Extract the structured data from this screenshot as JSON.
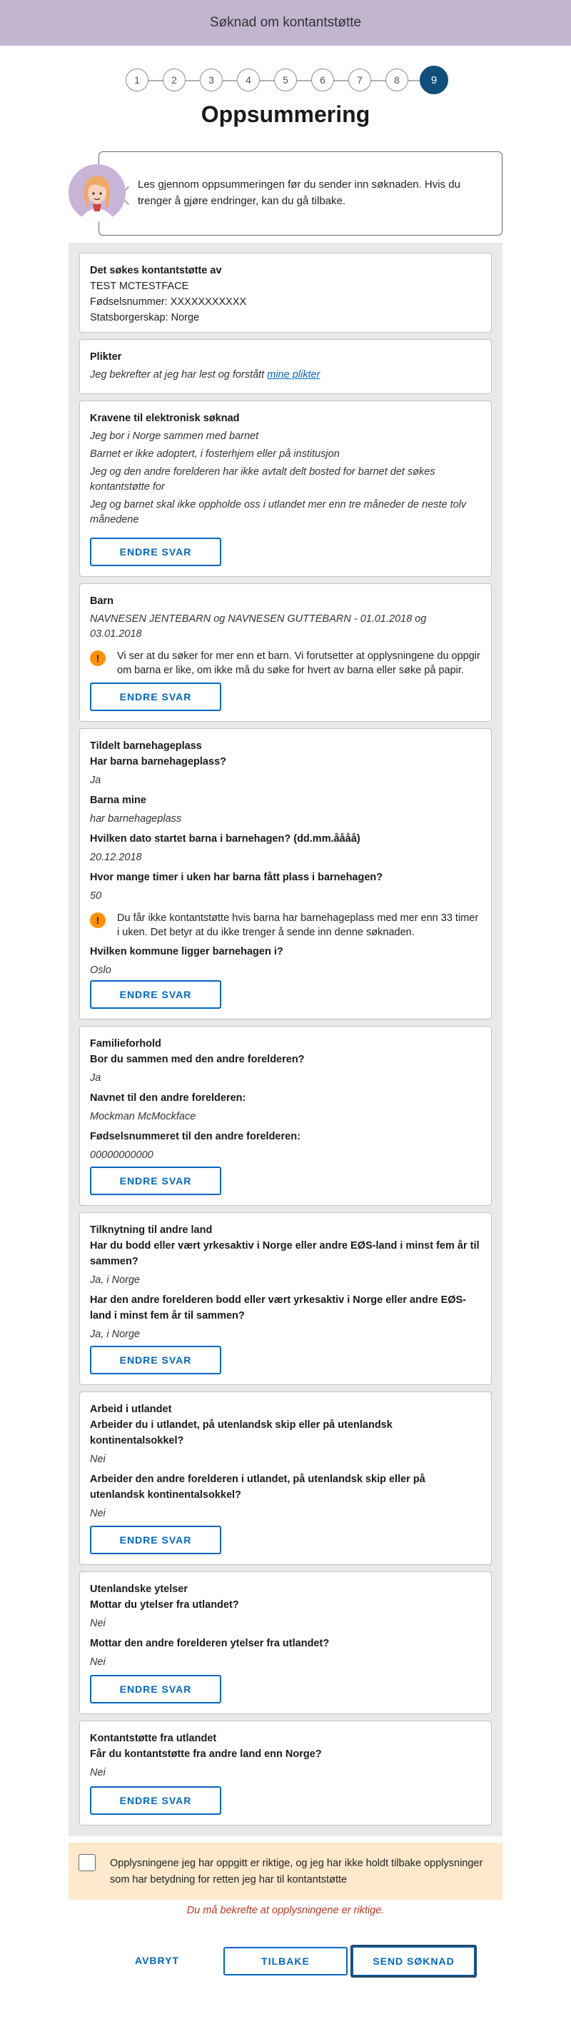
{
  "header": {
    "title": "Søknad om kontantstøtte"
  },
  "stepper": {
    "steps": [
      "1",
      "2",
      "3",
      "4",
      "5",
      "6",
      "7",
      "8",
      "9"
    ],
    "current": 9
  },
  "page": {
    "title": "Oppsummering"
  },
  "guide": {
    "text": "Les gjennom oppsummeringen før du sender inn søknaden. Hvis du trenger å gjøre endringer, kan du gå tilbake."
  },
  "edit_label": "ENDRE SVAR",
  "sections": {
    "applicant": {
      "title": "Det søkes kontantstøtte av",
      "name": "TEST MCTESTFACE",
      "ssn": "Fødselsnummer: XXXXXXXXXXX",
      "citizenship": "Statsborgerskap: Norge"
    },
    "duties": {
      "title": "Plikter",
      "text": "Jeg bekrefter at jeg har lest og forstått ",
      "link": "mine plikter"
    },
    "requirements": {
      "title": "Kravene til elektronisk søknad",
      "items": [
        "Jeg bor i Norge sammen med barnet",
        "Barnet er ikke adoptert, i fosterhjem eller på institusjon",
        "Jeg og den andre forelderen har ikke avtalt delt bosted for barnet det søkes kontantstøtte for",
        "Jeg og barnet skal ikke oppholde oss i utlandet mer enn tre måneder de neste tolv månedene"
      ]
    },
    "children": {
      "title": "Barn",
      "text": "NAVNESEN JENTEBARN og NAVNESEN GUTTEBARN - 01.01.2018 og 03.01.2018",
      "alert": "Vi ser at du søker for mer enn et barn. Vi forutsetter at opplysningene du oppgir om barna er like, om ikke må du søke for hvert av barna eller søke på papir."
    },
    "kindergarten": {
      "title": "Tildelt barnehageplass",
      "q1": "Har barna barnehageplass?",
      "a1": "Ja",
      "q2": "Barna mine",
      "a2": "har barnehageplass",
      "q3": "Hvilken dato startet barna i barnehagen? (dd.mm.åååå)",
      "a3": "20.12.2018",
      "q4": "Hvor mange timer i uken har barna fått plass i barnehagen?",
      "a4": "50",
      "alert": "Du får ikke kontantstøtte hvis barna har barnehageplass med mer enn 33 timer i uken. Det betyr at du ikke trenger å sende inn denne søknaden.",
      "q5": "Hvilken kommune ligger barnehagen i?",
      "a5": "Oslo"
    },
    "family": {
      "title": "Familieforhold",
      "q1": "Bor du sammen med den andre forelderen?",
      "a1": "Ja",
      "q2": "Navnet til den andre forelderen:",
      "a2": "Mockman McMockface",
      "q3": "Fødselsnummeret til den andre forelderen:",
      "a3": "00000000000"
    },
    "ties": {
      "title": "Tilknytning til andre land",
      "q1": "Har du bodd eller vært yrkesaktiv i Norge eller andre EØS-land i minst fem år til sammen?",
      "a1": "Ja, i Norge",
      "q2": "Har den andre forelderen bodd eller vært yrkesaktiv i Norge eller andre EØS-land i minst fem år til sammen?",
      "a2": "Ja, i Norge"
    },
    "work_abroad": {
      "title": "Arbeid i utlandet",
      "q1": "Arbeider du i utlandet, på utenlandsk skip eller på utenlandsk kontinentalsokkel?",
      "a1": "Nei",
      "q2": "Arbeider den andre forelderen i utlandet, på utenlandsk skip eller på utenlandsk kontinentalsokkel?",
      "a2": "Nei"
    },
    "foreign_benefits": {
      "title": "Utenlandske ytelser",
      "q1": "Mottar du ytelser fra utlandet?",
      "a1": "Nei",
      "q2": "Mottar den andre forelderen ytelser fra utlandet?",
      "a2": "Nei"
    },
    "foreign_support": {
      "title": "Kontantstøtte fra utlandet",
      "q1": "Får du kontantstøtte fra andre land enn Norge?",
      "a1": "Nei"
    }
  },
  "confirm": {
    "text": "Opplysningene jeg har oppgitt er riktige, og jeg har ikke holdt tilbake opplysninger som har betydning for retten jeg har til kontantstøtte",
    "checked": false
  },
  "error": "Du må bekrefte at opplysningene er riktige.",
  "actions": {
    "cancel": "AVBRYT",
    "back": "TILBAKE",
    "send": "SEND SØKNAD"
  },
  "colors": {
    "header_bg": "#c1b5d0",
    "active_step": "#0e4f7b",
    "link": "#0067c5",
    "warning": "#ff9100",
    "error": "#ba3a26",
    "confirm_bg": "#ffe9cc"
  }
}
